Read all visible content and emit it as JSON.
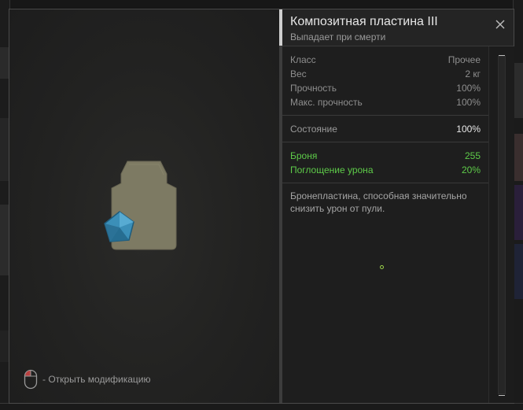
{
  "item": {
    "title": "Композитная пластина III",
    "subtitle": "Выпадает при смерти"
  },
  "stats_general": [
    {
      "label": "Класс",
      "value": "Прочее"
    },
    {
      "label": "Вес",
      "value": "2 кг"
    },
    {
      "label": "Прочность",
      "value": "100%"
    },
    {
      "label": "Макс. прочность",
      "value": "100%"
    }
  ],
  "condition": {
    "label": "Состояние",
    "value": "100%"
  },
  "stats_armor": [
    {
      "label": "Броня",
      "value": "255"
    },
    {
      "label": "Поглощение урона",
      "value": "20%"
    }
  ],
  "description": "Бронепластина, способная значительно снизить урон от пули.",
  "hint": {
    "text": "- Открыть модификацию"
  },
  "icons": {
    "close": "close-icon",
    "mouse": "mouse-icon",
    "gem": "artifact-gem-icon"
  },
  "colors": {
    "accent_green": "#5ecb49",
    "plate": "#7d7a63",
    "gem": "#3b8fb8"
  }
}
